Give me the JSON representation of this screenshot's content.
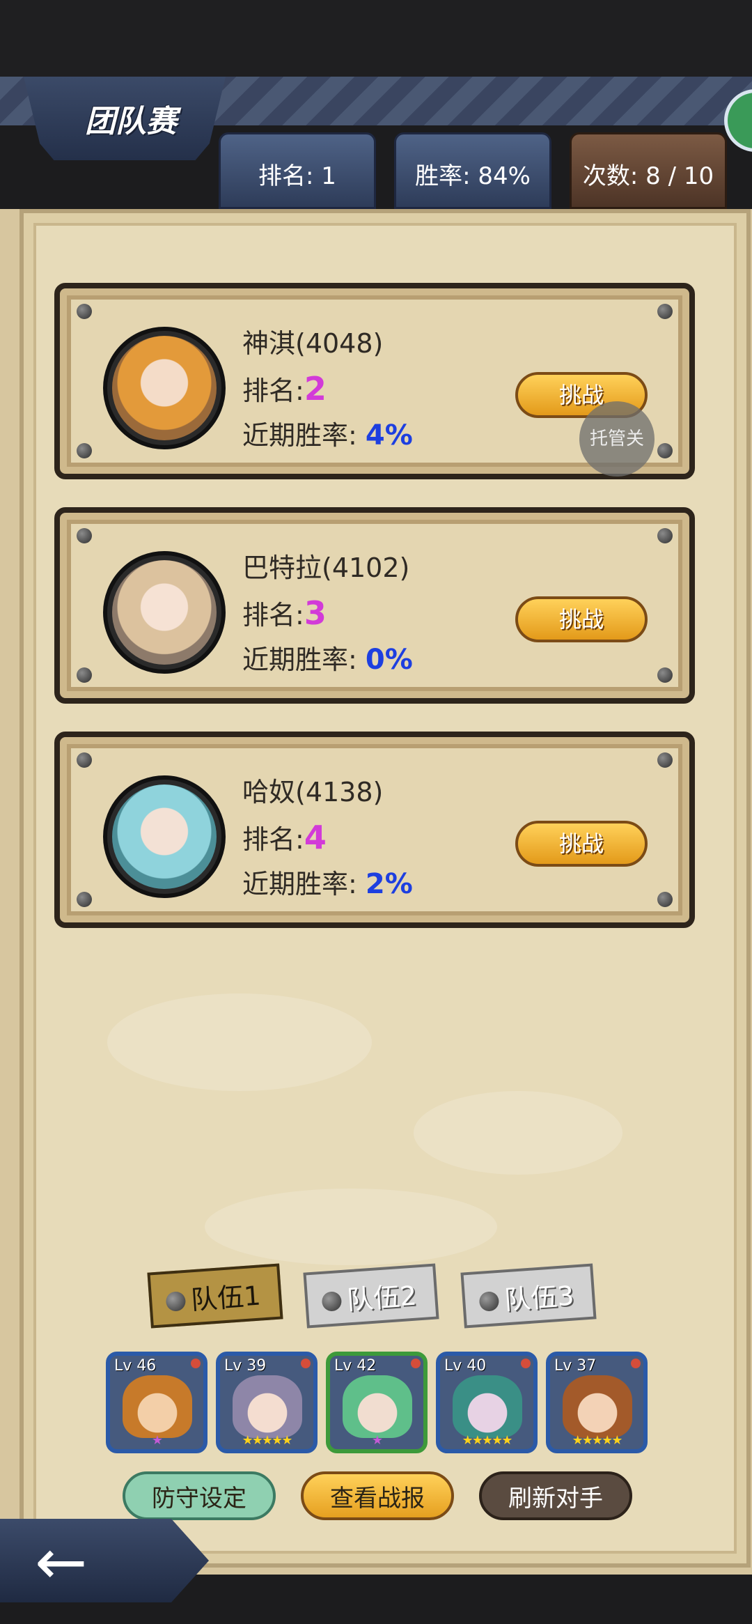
{
  "header": {
    "title": "团队赛",
    "tabs": [
      {
        "label": "排名: 1"
      },
      {
        "label": "胜率: 84%"
      },
      {
        "label": "次数: 8 / 10"
      }
    ]
  },
  "opponents": [
    {
      "name": "神淇(4048)",
      "rank_label": "排名:",
      "rank": "2",
      "rate_label": "近期胜率:",
      "rate": "4%",
      "button": "挑战"
    },
    {
      "name": "巴特拉(4102)",
      "rank_label": "排名:",
      "rank": "3",
      "rate_label": "近期胜率:",
      "rate": "0%",
      "button": "挑战"
    },
    {
      "name": "哈奴(4138)",
      "rank_label": "排名:",
      "rank": "4",
      "rate_label": "近期胜率:",
      "rate": "2%",
      "button": "挑战"
    }
  ],
  "float_button": "托管关",
  "team_tabs": [
    {
      "label": "队伍1"
    },
    {
      "label": "队伍2"
    },
    {
      "label": "队伍3"
    }
  ],
  "heroes": [
    {
      "level": "Lv 46",
      "stars": "★"
    },
    {
      "level": "Lv 39",
      "stars": "★★★★★"
    },
    {
      "level": "Lv 42",
      "stars": "★"
    },
    {
      "level": "Lv 40",
      "stars": "★★★★★"
    },
    {
      "level": "Lv 37",
      "stars": "★★★★★"
    }
  ],
  "actions": {
    "defense": "防守设定",
    "report": "查看战报",
    "refresh": "刷新对手"
  },
  "colors": {
    "rank_value": "#d23ad8",
    "rate_value": "#1d3fe0",
    "challenge_button": "#f2b83a"
  },
  "icons": {
    "back": "back-arrow-icon",
    "chat": "chat-bubble-icon",
    "rivet": "rivet-icon"
  }
}
